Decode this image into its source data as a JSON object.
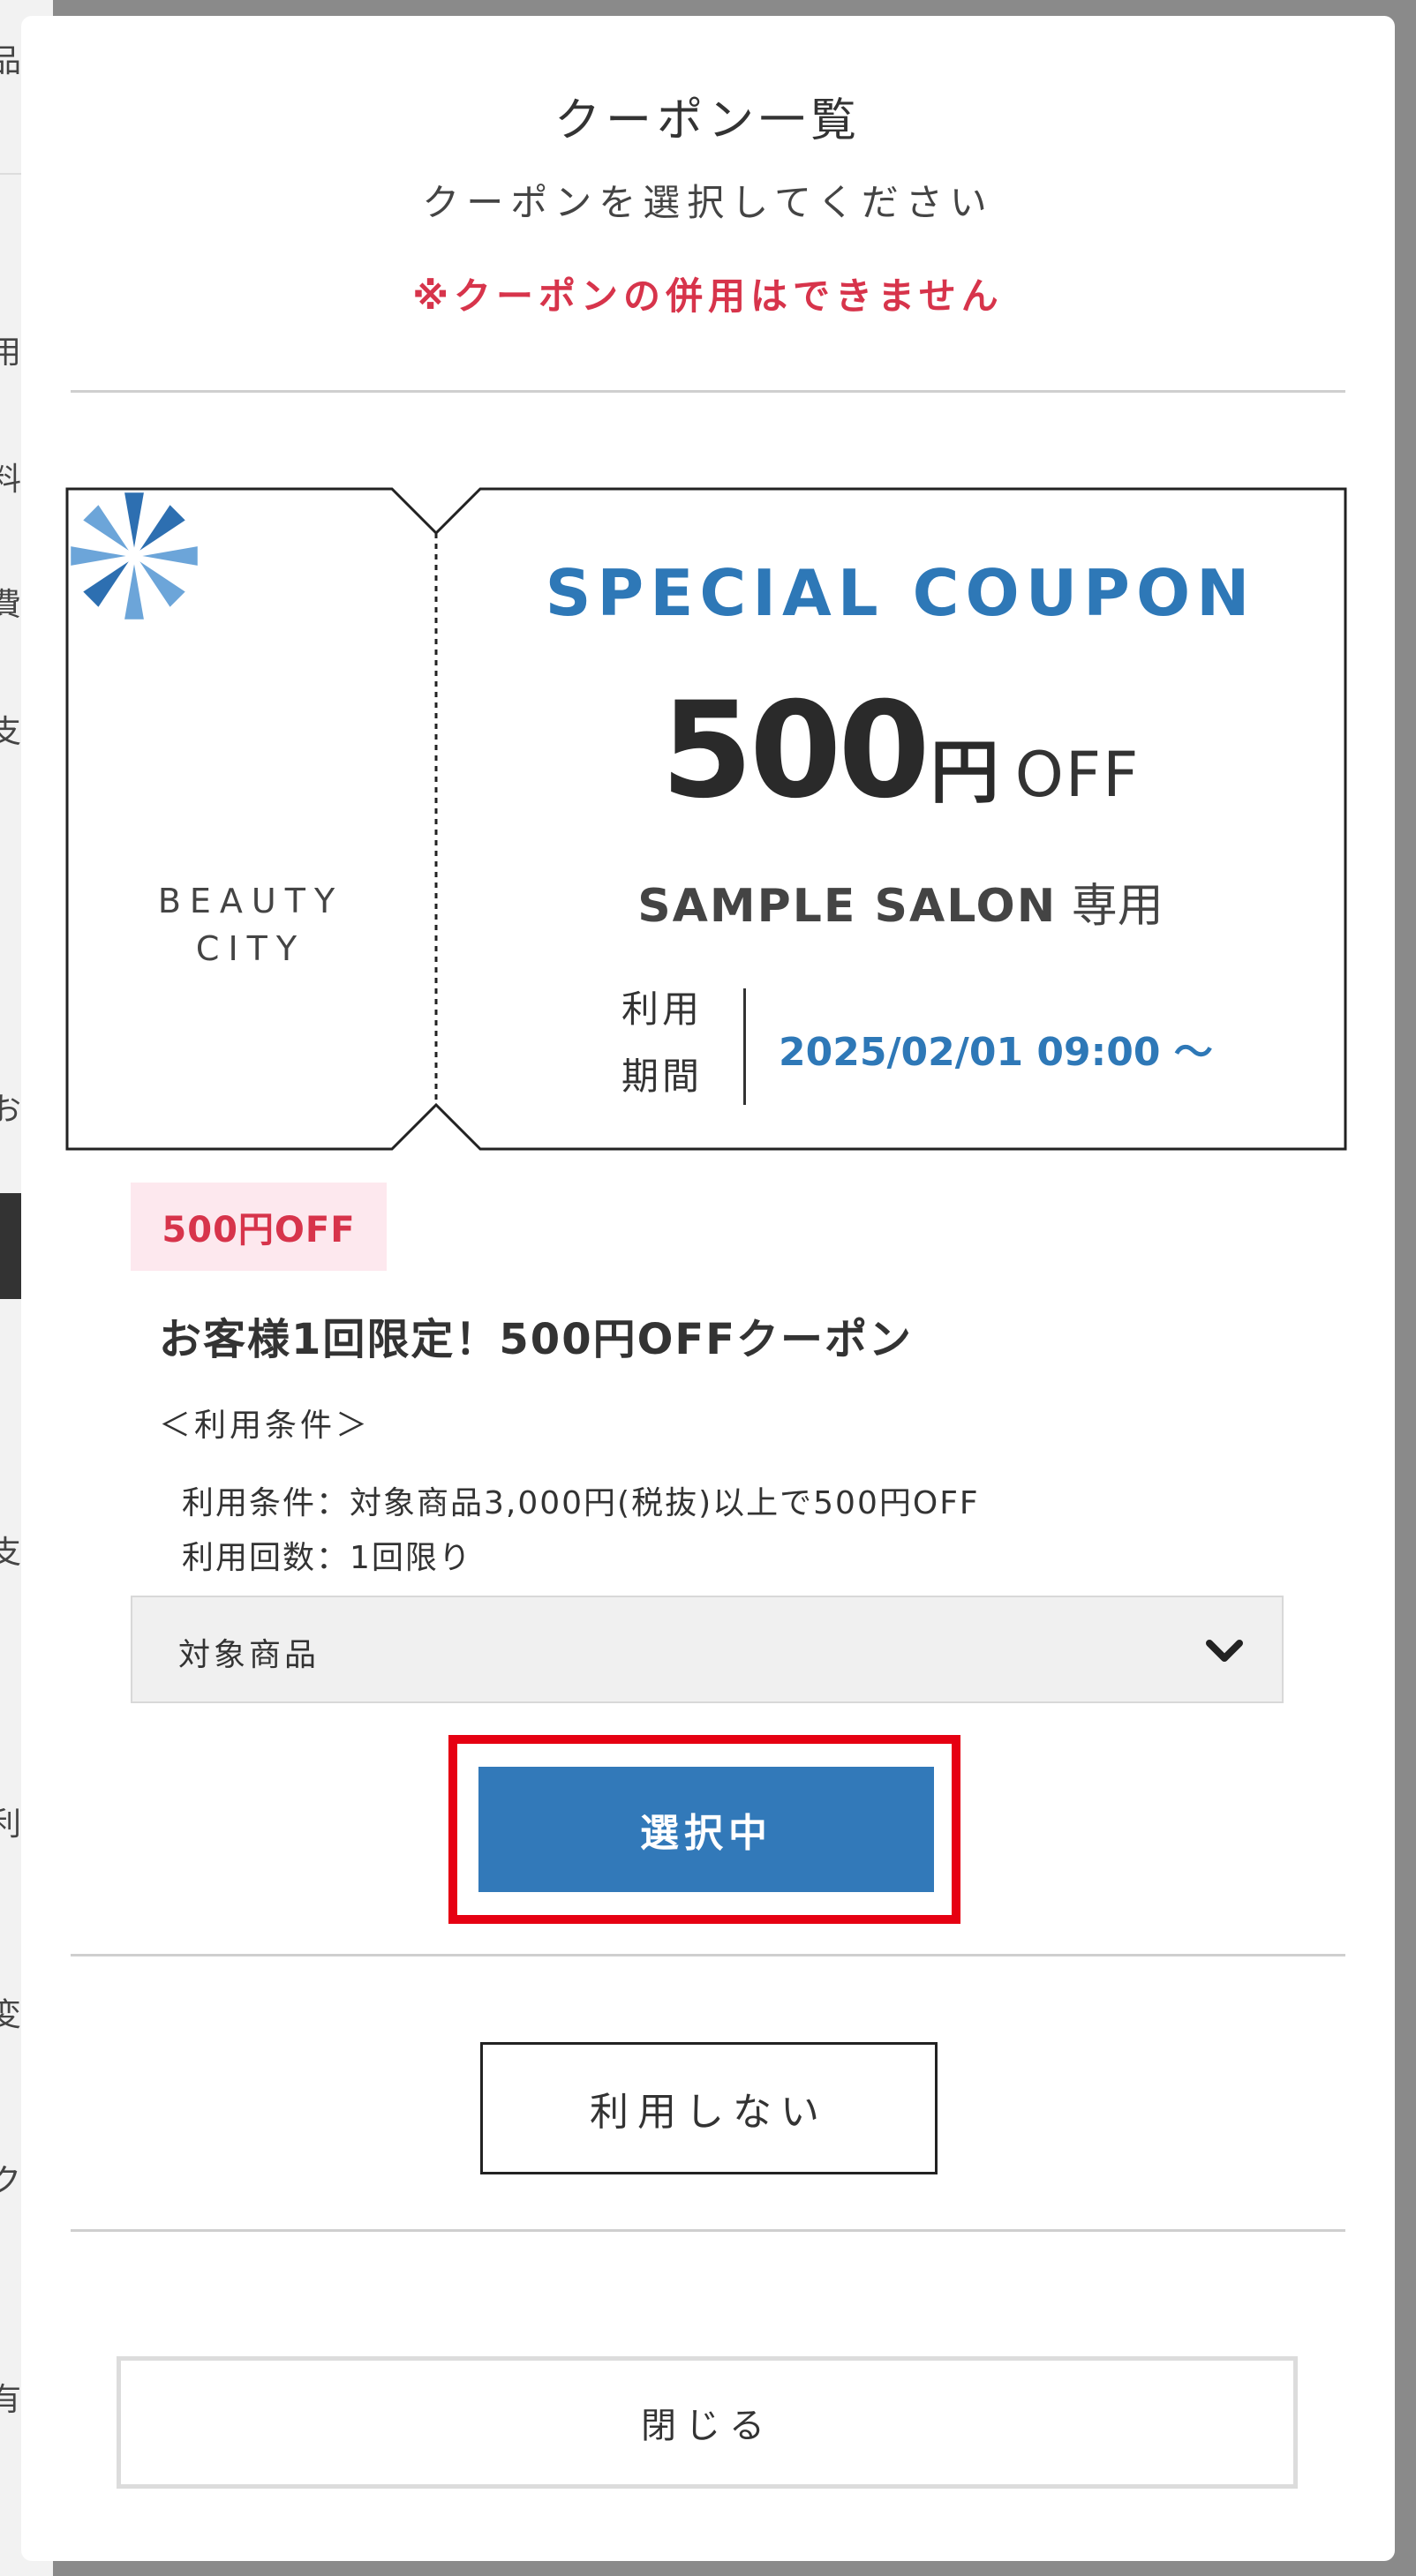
{
  "background_fragments": [
    "品",
    "用",
    "料",
    "費",
    "支",
    "お",
    "支",
    "利",
    "変",
    "ク",
    "有"
  ],
  "modal": {
    "title": "クーポン一覧",
    "subtitle": "クーポンを選択してください",
    "warning": "※クーポンの併用はできません"
  },
  "coupon": {
    "logo_text_line1": "BEAUTY",
    "logo_text_line2": "CITY",
    "heading": "SPECIAL COUPON",
    "amount": "500",
    "currency": "円",
    "off": "OFF",
    "salon_name": "SAMPLE SALON",
    "salon_suffix": "専用",
    "period_label_line1": "利用",
    "period_label_line2": "期間",
    "period_value": "2025/02/01 09:00 〜",
    "badge": "500円OFF",
    "title": "お客様1回限定！500円OFFクーポン",
    "conditions_heading": "＜利用条件＞",
    "conditions": [
      "利用条件：対象商品3,000円(税抜)以上で500円OFF",
      "利用回数：1回限り"
    ],
    "target_products_label": "対象商品"
  },
  "buttons": {
    "selected": "選択中",
    "not_use": "利用しない",
    "close": "閉じる"
  },
  "colors": {
    "accent_blue": "#3279b9",
    "warning_red": "#d7344b",
    "highlight_red": "#e60012",
    "badge_bg": "#fde8ee"
  },
  "icons": [
    "beauty-city-logo",
    "chevron-down-icon"
  ]
}
